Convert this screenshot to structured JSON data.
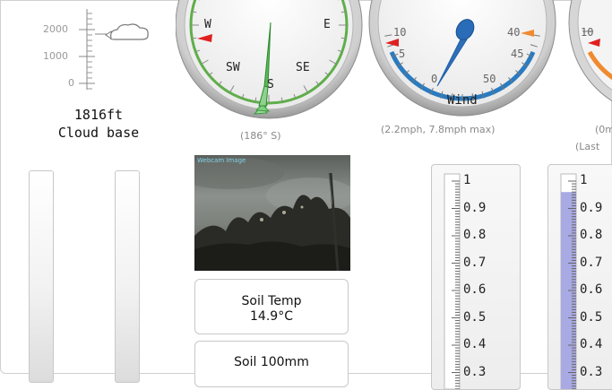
{
  "cloud_base": {
    "axis_labels": [
      "2000",
      "1000",
      "0"
    ],
    "value": "1816ft",
    "label": "Cloud base",
    "icon": "cloud-icon"
  },
  "compass": {
    "labels": {
      "w": "W",
      "e": "E",
      "sw": "SW",
      "se": "SE",
      "s": "S"
    },
    "reading": "(186° S)",
    "direction_deg": 186
  },
  "wind": {
    "scale_labels": [
      "10",
      "5",
      "0",
      "50",
      "45",
      "40"
    ],
    "label": "Wind",
    "reading": "(2.2mph, 7.8mph max)",
    "speed_mph": 2.2,
    "max_mph": 7.8
  },
  "next_gauge": {
    "partial_label": "10",
    "reading_line1": "(0m",
    "reading_line2": "(Last"
  },
  "webcam": {
    "stamp": "Webcam Image"
  },
  "soil_temp": {
    "label": "Soil Temp",
    "value": "14.9°C"
  },
  "soil_moisture": {
    "label": "Soil 100mm"
  },
  "meter_left": {
    "scale": [
      "1",
      "0.9",
      "0.8",
      "0.7",
      "0.6",
      "0.5",
      "0.4",
      "0.3"
    ],
    "level": 0.0
  },
  "meter_right": {
    "scale": [
      "1",
      "0.9",
      "0.8",
      "0.7",
      "0.6",
      "0.5",
      "0.4",
      "0.3"
    ],
    "level": 0.96
  },
  "colors": {
    "compass_needle": "#4db84d",
    "compass_ring": "#5fae4a",
    "wind_ring": "#2a7bc0",
    "wind_needle": "#1f5fa8",
    "red_marker": "#e02020",
    "orange_marker": "#f08a30",
    "meter_fill": "#a9a9e3"
  }
}
